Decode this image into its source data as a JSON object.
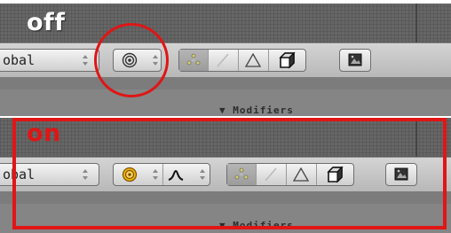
{
  "off_panel": {
    "title": "off",
    "transform_orientation_value": "obal",
    "modifiers_label": "▼ Modifiers"
  },
  "on_panel": {
    "title": "on",
    "transform_orientation_value": "obal",
    "modifiers_label": "▼ Modifiers"
  },
  "icons": {
    "pivot": "pivot-point-icon",
    "proportional": "proportional-falloff-icon",
    "vertex": "vertex-select-icon",
    "edge": "edge-select-icon",
    "face": "face-select-icon",
    "occlude": "occlude-geometry-icon",
    "render": "render-image-icon"
  },
  "colors": {
    "highlight": "#e01515",
    "pivot_on": "#e8a000"
  }
}
